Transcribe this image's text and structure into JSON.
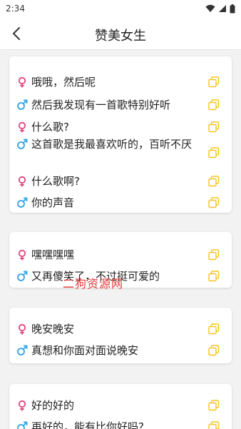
{
  "status_bar": {
    "time": "2:34"
  },
  "header": {
    "title": "赞美女生"
  },
  "colors": {
    "female": "#e0457b",
    "male": "#2fa4e7",
    "copy": "#f5c518"
  },
  "cards": [
    {
      "lines": [
        {
          "gender": "female",
          "text": "哦哦，然后呢"
        },
        {
          "gender": "male",
          "text": "然后我发现有一首歌特别好听"
        },
        {
          "gender": "female",
          "text": "什么歌?"
        },
        {
          "gender": "male",
          "text": "这首歌是我最喜欢听的，百听不厌"
        },
        {
          "gender": "female",
          "text": "什么歌啊?"
        },
        {
          "gender": "male",
          "text": "你的声音"
        }
      ]
    },
    {
      "lines": [
        {
          "gender": "female",
          "text": "嘿嘿嘿嘿"
        },
        {
          "gender": "male",
          "text": "又再傻笑了，不过挺可爱的"
        }
      ]
    },
    {
      "lines": [
        {
          "gender": "female",
          "text": "晚安晚安"
        },
        {
          "gender": "male",
          "text": "真想和你面对面说晚安"
        }
      ]
    },
    {
      "lines": [
        {
          "gender": "female",
          "text": "好的好的"
        },
        {
          "gender": "male",
          "text": "再好的，能有比你好吗?"
        }
      ]
    }
  ],
  "watermark": "二狗资源网"
}
